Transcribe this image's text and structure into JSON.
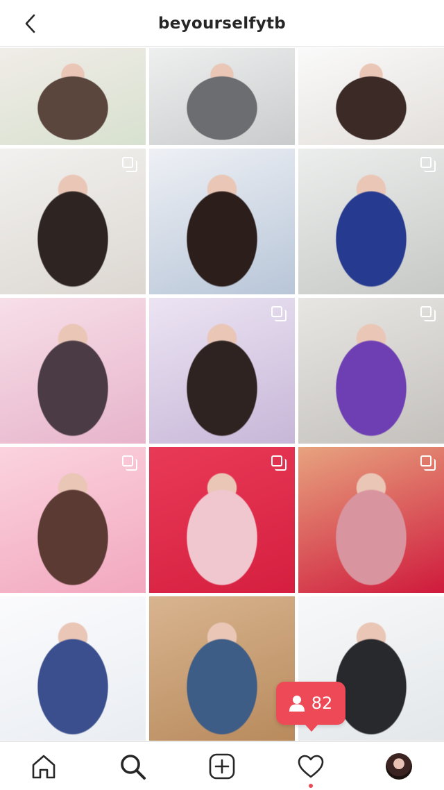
{
  "header": {
    "title": "beyourselfytb"
  },
  "grid": {
    "posts": [
      {
        "multi": false,
        "colors": [
          "#d7e1cf",
          "#f1ece8",
          "#5b463d"
        ]
      },
      {
        "multi": false,
        "colors": [
          "#c9cbcc",
          "#eef0f0",
          "#6b6d70"
        ]
      },
      {
        "multi": false,
        "colors": [
          "#e3dfdb",
          "#fafafa",
          "#3b2a25"
        ]
      },
      {
        "multi": true,
        "colors": [
          "#dcd7d1",
          "#f2f1ef",
          "#2e2522"
        ]
      },
      {
        "multi": false,
        "colors": [
          "#b8c6d8",
          "#eef0f5",
          "#2b1e1b"
        ]
      },
      {
        "multi": true,
        "colors": [
          "#c7c9c7",
          "#eceeed",
          "#263b8f"
        ]
      },
      {
        "multi": false,
        "colors": [
          "#e7b4cb",
          "#f7dfe8",
          "#4b3b45"
        ]
      },
      {
        "multi": true,
        "colors": [
          "#c7b7d8",
          "#ece4f3",
          "#2f2322"
        ]
      },
      {
        "multi": true,
        "colors": [
          "#c4c1bd",
          "#e8e6e3",
          "#6d3fb3"
        ]
      },
      {
        "multi": true,
        "colors": [
          "#f2a8bf",
          "#fbd3df",
          "#5a3a32"
        ]
      },
      {
        "multi": true,
        "colors": [
          "#d61f40",
          "#e83a57",
          "#f0c6cf"
        ]
      },
      {
        "multi": true,
        "colors": [
          "#cf1a3c",
          "#e7a37f",
          "#d9959f"
        ]
      },
      {
        "multi": false,
        "colors": [
          "#e9edf2",
          "#fbfbfd",
          "#3b4f8f"
        ]
      },
      {
        "multi": false,
        "colors": [
          "#b88a5c",
          "#d8b48f",
          "#3e5d86"
        ]
      },
      {
        "multi": false,
        "colors": [
          "#e3e7ea",
          "#f7f8f9",
          "#27292d"
        ]
      }
    ]
  },
  "notification": {
    "count": "82",
    "icon": "person-icon"
  },
  "nav": {
    "items": [
      "home-icon",
      "search-icon",
      "new-post-icon",
      "activity-heart-icon",
      "profile-avatar"
    ]
  }
}
